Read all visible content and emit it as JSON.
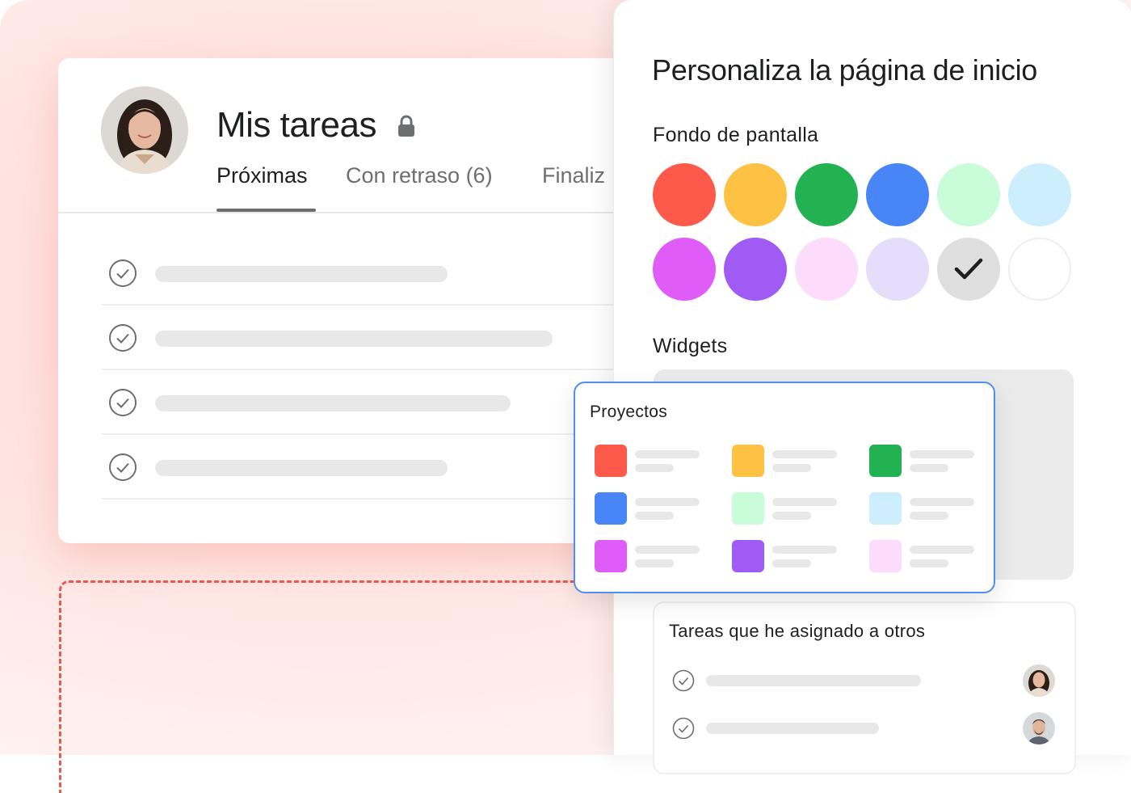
{
  "colors": {
    "accent_dashed": "#ea5a4f",
    "selection_border": "#4e8ff0",
    "placeholder_bar": "#e8e8e8"
  },
  "tasks_card": {
    "title": "Mis tareas",
    "lock_icon": "lock-icon",
    "tabs": [
      {
        "label": "Próximas",
        "active": true
      },
      {
        "label": "Con retraso (6)",
        "active": false
      },
      {
        "label": "Finaliz",
        "active": false
      }
    ],
    "task_rows": [
      {
        "icon": "check-circle-icon"
      },
      {
        "icon": "check-circle-icon"
      },
      {
        "icon": "check-circle-icon"
      },
      {
        "icon": "check-circle-icon"
      }
    ]
  },
  "customize_panel": {
    "title": "Personaliza la página de inicio",
    "wallpaper_label": "Fondo de pantalla",
    "wallpaper_swatches": [
      {
        "color": "#fd5a4b",
        "selected": false
      },
      {
        "color": "#fdc244",
        "selected": false
      },
      {
        "color": "#22b251",
        "selected": false
      },
      {
        "color": "#4886f8",
        "selected": false
      },
      {
        "color": "#c9fcd9",
        "selected": false
      },
      {
        "color": "#cdeefd",
        "selected": false
      },
      {
        "color": "#e05cf8",
        "selected": false
      },
      {
        "color": "#a05bf5",
        "selected": false
      },
      {
        "color": "#fcdcfb",
        "selected": false
      },
      {
        "color": "#e5defb",
        "selected": false
      },
      {
        "color": "#dfdfdf",
        "selected": true
      },
      {
        "color": "#ffffff",
        "selected": false
      }
    ],
    "widgets_label": "Widgets",
    "assigned_widget": {
      "title": "Tareas que he asignado a otros",
      "rows": [
        {
          "icon": "check-circle-icon",
          "avatar": "woman-avatar"
        },
        {
          "icon": "check-circle-icon",
          "avatar": "man-avatar"
        }
      ]
    }
  },
  "projects_widget": {
    "title": "Proyectos",
    "projects": [
      {
        "color": "#fd5a4b"
      },
      {
        "color": "#fdc244"
      },
      {
        "color": "#22b251"
      },
      {
        "color": "#4886f8"
      },
      {
        "color": "#c9fcd9"
      },
      {
        "color": "#cdeefd"
      },
      {
        "color": "#e05cf8"
      },
      {
        "color": "#a05bf5"
      },
      {
        "color": "#fcdcfb"
      }
    ]
  }
}
